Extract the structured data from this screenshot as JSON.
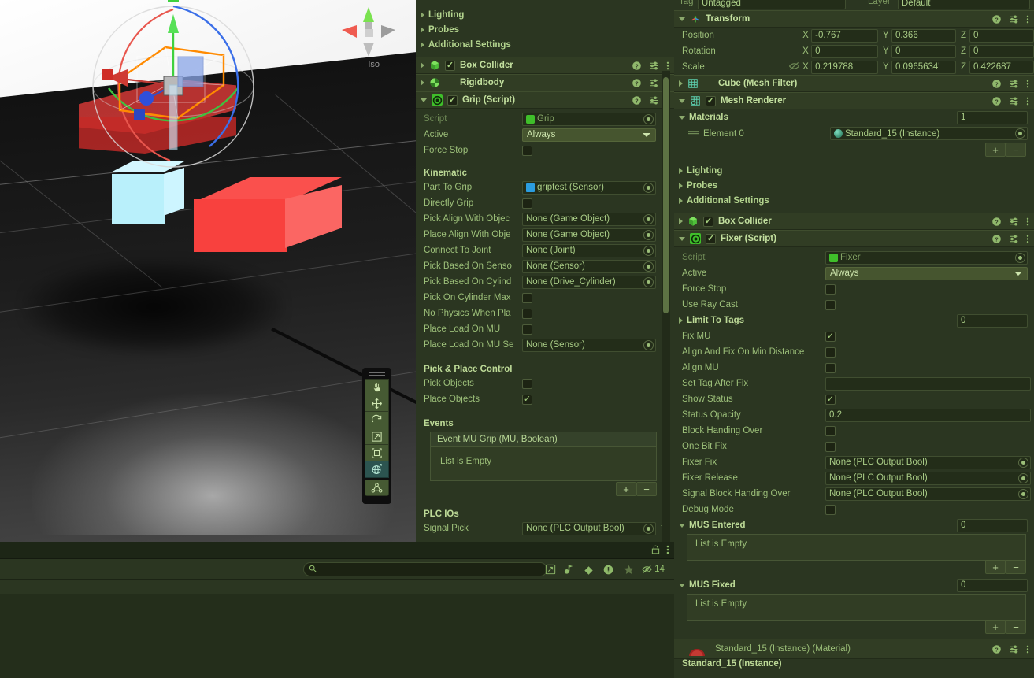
{
  "scene": {
    "view_orientation_label": "Iso",
    "tools": [
      {
        "name": "hand-tool",
        "glyph": "✋",
        "active": false
      },
      {
        "name": "move-tool",
        "glyph": "move",
        "active": false
      },
      {
        "name": "rotate-tool",
        "glyph": "rotate",
        "active": false
      },
      {
        "name": "scale-tool",
        "glyph": "scale",
        "active": false
      },
      {
        "name": "rect-tool",
        "glyph": "rect",
        "active": false
      },
      {
        "name": "transform-tool",
        "glyph": "transform",
        "active": true
      },
      {
        "name": "custom-editor-tool",
        "glyph": "custom",
        "active": false
      }
    ]
  },
  "project_panel": {
    "search_placeholder": "",
    "search_value": "",
    "hidden_count": "14"
  },
  "inspector_middle": {
    "collapsed_sections": [
      "Lighting",
      "Probes",
      "Additional Settings"
    ],
    "components": [
      {
        "name": "Box Collider",
        "enabled": true,
        "expanded": false,
        "icon": "box-collider-icon"
      },
      {
        "name": "Rigidbody",
        "enabled": null,
        "expanded": false,
        "icon": "rigidbody-icon"
      },
      {
        "name": "Grip (Script)",
        "enabled": true,
        "expanded": true,
        "icon": "script-icon"
      }
    ],
    "grip": {
      "script_label": "Script",
      "script_value": "Grip",
      "active_label": "Active",
      "active_value": "Always",
      "force_stop_label": "Force Stop",
      "force_stop_value": false,
      "kinematic_header": "Kinematic",
      "fields": [
        {
          "label": "Part To Grip",
          "type": "object-blue",
          "value": "griptest (Sensor)"
        },
        {
          "label": "Directly Grip",
          "type": "checkbox",
          "value": false
        },
        {
          "label": "Pick Align With Objec",
          "type": "object",
          "value": "None (Game Object)"
        },
        {
          "label": "Place Align With Obje",
          "type": "object",
          "value": "None (Game Object)"
        },
        {
          "label": "Connect To Joint",
          "type": "object",
          "value": "None (Joint)"
        },
        {
          "label": "Pick Based On Senso",
          "type": "object",
          "value": "None (Sensor)"
        },
        {
          "label": "Pick Based On Cylind",
          "type": "object",
          "value": "None (Drive_Cylinder)"
        },
        {
          "label": "Pick On Cylinder Max",
          "type": "checkbox",
          "value": false
        },
        {
          "label": "No Physics When Pla",
          "type": "checkbox",
          "value": false
        },
        {
          "label": "Place Load On MU",
          "type": "checkbox",
          "value": false
        },
        {
          "label": "Place Load On MU Se",
          "type": "object",
          "value": "None (Sensor)"
        }
      ],
      "pick_place_header": "Pick & Place Control",
      "pick_place": [
        {
          "label": "Pick Objects",
          "value": false
        },
        {
          "label": "Place Objects",
          "value": true
        }
      ],
      "events_header": "Events",
      "event_list_title": "Event MU Grip (MU, Boolean)",
      "event_list_empty": "List is Empty",
      "add_label": "+",
      "remove_label": "−",
      "plc_header": "PLC IOs",
      "plc_row_label": "Signal Pick",
      "plc_row_value": "None (PLC Output Bool)"
    }
  },
  "inspector_right": {
    "tag_label": "Tag",
    "tag_value": "Untagged",
    "layer_label": "Layer",
    "layer_value": "Default",
    "transform": {
      "title": "Transform",
      "rows": [
        {
          "label": "Position",
          "x": "-0.767",
          "y": "0.366",
          "z": "0"
        },
        {
          "label": "Rotation",
          "x": "0",
          "y": "0",
          "z": "0"
        },
        {
          "label": "Scale",
          "x": "0.219788",
          "y": "0.0965634'",
          "z": "0.422687"
        }
      ],
      "axis_x": "X",
      "axis_y": "Y",
      "axis_z": "Z"
    },
    "mesh_filter_title": "Cube (Mesh Filter)",
    "mesh_renderer_title": "Mesh Renderer",
    "materials_label": "Materials",
    "materials_count": "1",
    "material_element_label": "Element 0",
    "material_element_value": "Standard_15 (Instance)",
    "collapsed_sections": [
      "Lighting",
      "Probes",
      "Additional Settings"
    ],
    "box_collider_title": "Box Collider",
    "fixer_title": "Fixer (Script)",
    "fixer": {
      "script_label": "Script",
      "script_value": "Fixer",
      "rows": [
        {
          "label": "Active",
          "type": "dropdown",
          "value": "Always"
        },
        {
          "label": "Force Stop",
          "type": "checkbox",
          "value": false
        },
        {
          "label": "Use Ray Cast",
          "type": "checkbox",
          "value": false
        }
      ],
      "limit_to_tags_label": "Limit To Tags",
      "limit_to_tags_count": "0",
      "rows2": [
        {
          "label": "Fix MU",
          "type": "checkbox",
          "value": true
        },
        {
          "label": "Align And Fix On Min Distance",
          "type": "checkbox",
          "value": false
        },
        {
          "label": "Align MU",
          "type": "checkbox",
          "value": false
        },
        {
          "label": "Set Tag After Fix",
          "type": "text",
          "value": ""
        },
        {
          "label": "Show Status",
          "type": "checkbox",
          "value": true
        },
        {
          "label": "Status Opacity",
          "type": "text",
          "value": "0.2"
        },
        {
          "label": "Block Handing Over",
          "type": "checkbox",
          "value": false
        },
        {
          "label": "One Bit Fix",
          "type": "checkbox",
          "value": false
        },
        {
          "label": "Fixer Fix",
          "type": "object",
          "value": "None (PLC Output Bool)"
        },
        {
          "label": "Fixer Release",
          "type": "object",
          "value": "None (PLC Output Bool)"
        },
        {
          "label": "Signal Block Handing Over",
          "type": "object",
          "value": "None (PLC Output Bool)"
        },
        {
          "label": "Debug Mode",
          "type": "checkbox",
          "value": false
        }
      ],
      "mus_entered_label": "MUS Entered",
      "mus_entered_count": "0",
      "mus_entered_empty": "List is Empty",
      "mus_fixed_label": "MUS Fixed",
      "mus_fixed_count": "0",
      "mus_fixed_empty": "List is Empty",
      "add_label": "+",
      "remove_label": "−"
    },
    "material_header_title": "Standard_15 (Instance) (Material)",
    "material_subtitle": "Standard_15 (Instance)"
  },
  "colors": {
    "panel_bg": "#2b3621",
    "header_bg": "#313d24",
    "field_bg": "#232d19",
    "text": "#9cbf79",
    "accent_green": "#4fc03a",
    "dropdown_bg": "#46552f"
  }
}
